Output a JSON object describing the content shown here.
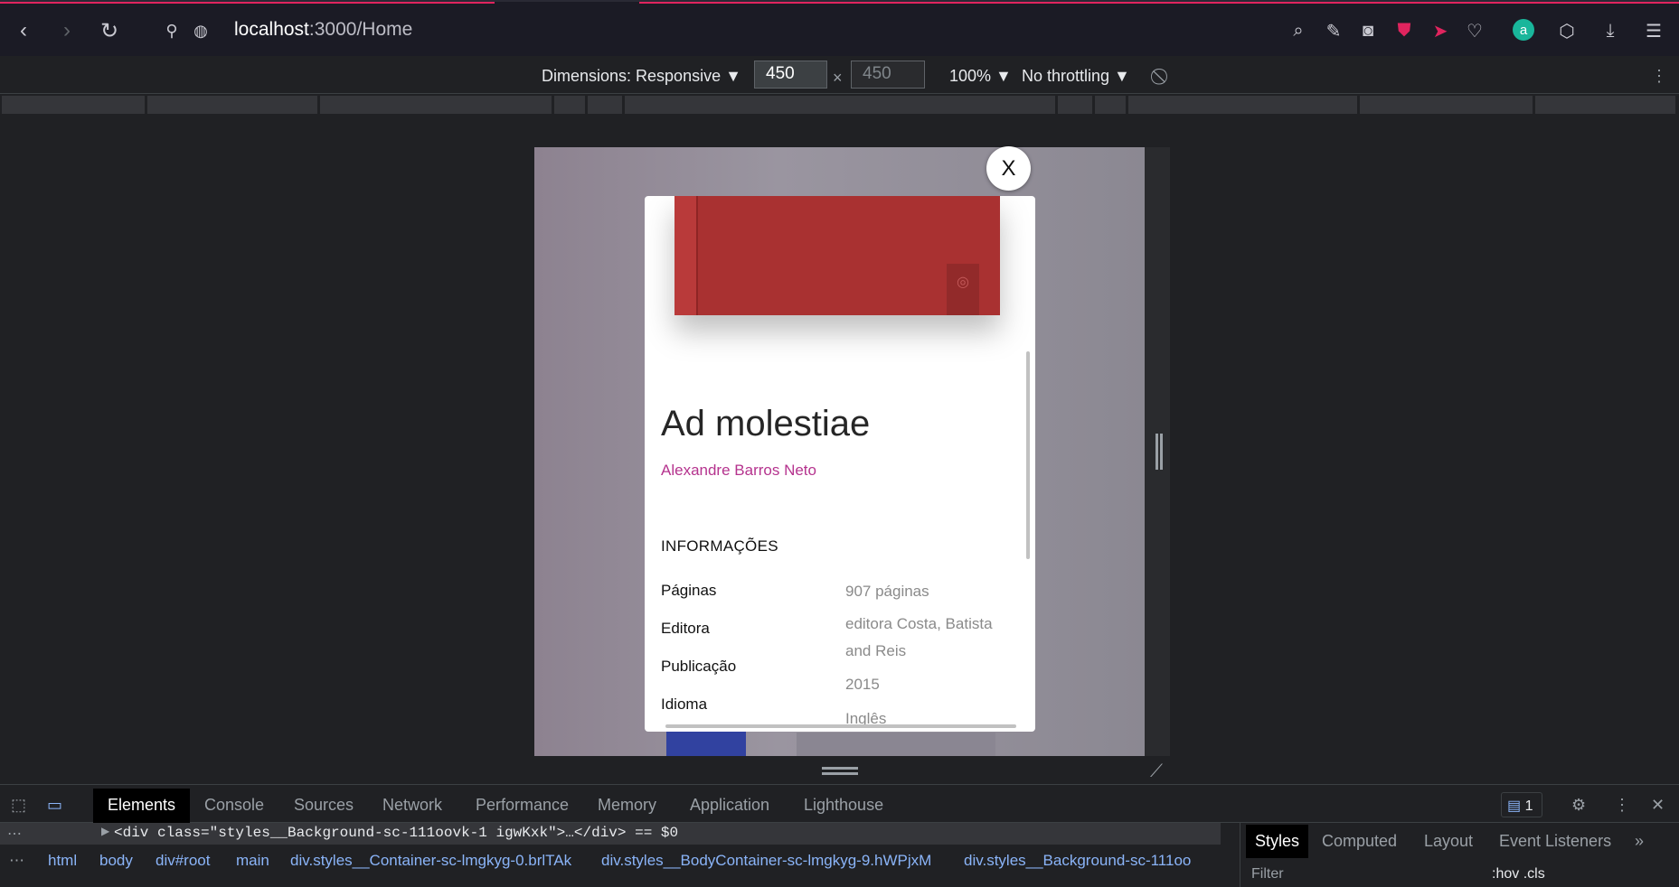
{
  "browser": {
    "url_host": "localhost",
    "url_path": ":3000/Home"
  },
  "device_toolbar": {
    "dimensions_label": "Dimensions: Responsive ▼",
    "width": "450",
    "height": "450",
    "times": "×",
    "zoom": "100% ▼",
    "throttling": "No throttling ▼"
  },
  "modal": {
    "close_label": "X",
    "title": "Ad molestiae",
    "author": "Alexandre Barros Neto",
    "info_heading": "INFORMAÇÕES",
    "labels": [
      "Páginas",
      "Editora",
      "Publicação",
      "Idioma"
    ],
    "values": [
      "907 páginas",
      "editora Costa, Batista",
      "and Reis",
      "2015",
      "Inglês"
    ]
  },
  "devtools": {
    "tabs": [
      "Elements",
      "Console",
      "Sources",
      "Network",
      "Performance",
      "Memory",
      "Application",
      "Lighthouse"
    ],
    "issues_count": "1",
    "dom_line": "<div class=\"styles__Background-sc-111oovk-1 igwKxk\">…</div> == $0",
    "breadcrumbs": [
      "html",
      "body",
      "div#root",
      "main",
      "div.styles__Container-sc-lmgkyg-0.brlTAk",
      "div.styles__BodyContainer-sc-lmgkyg-9.hWPjxM",
      "div.styles__Background-sc-111oo"
    ],
    "side_tabs": [
      "Styles",
      "Computed",
      "Layout",
      "Event Listeners"
    ],
    "filter": "Filter",
    "hov_cls": ":hov  .cls"
  },
  "colors": {
    "accent_author": "#b5338e",
    "cover": "#a93131"
  },
  "icons": [
    "back-icon",
    "forward-icon",
    "reload-icon",
    "site-info-icon",
    "globe-icon",
    "search-icon",
    "edit-icon",
    "camera-icon",
    "shield-icon",
    "send-icon",
    "heart-icon",
    "avatar-icon",
    "cube-icon",
    "download-icon",
    "settings-icon"
  ]
}
